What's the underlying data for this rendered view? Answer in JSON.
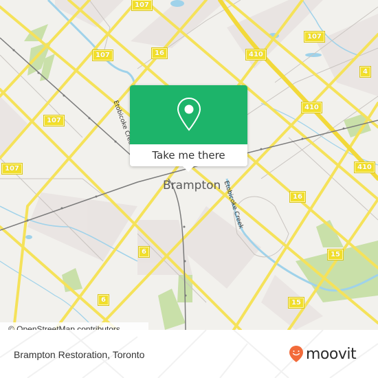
{
  "map": {
    "city_label": "Brampton",
    "creek_label_1": "Etobicoke Creek",
    "creek_label_2": "Etobicoke Creek",
    "route_shields": [
      "107",
      "107",
      "107",
      "107",
      "107",
      "16",
      "410",
      "410",
      "410",
      "4",
      "16",
      "6",
      "6",
      "15",
      "15"
    ],
    "colors": {
      "land": "#f2f1ed",
      "road_major": "#f5e25a",
      "park": "#c8dfa8",
      "water": "#9fd2ea",
      "railway": "#777777",
      "residential": "#e8e2e0"
    }
  },
  "popup": {
    "icon": "map-pin-icon",
    "button_label": "Take me there",
    "accent_color": "#1db46a"
  },
  "attribution": {
    "text": "© OpenStreetMap contributors"
  },
  "footer": {
    "place_name": "Brampton Restoration, Toronto",
    "brand_name": "moovit",
    "brand_color": "#f26b3a"
  }
}
